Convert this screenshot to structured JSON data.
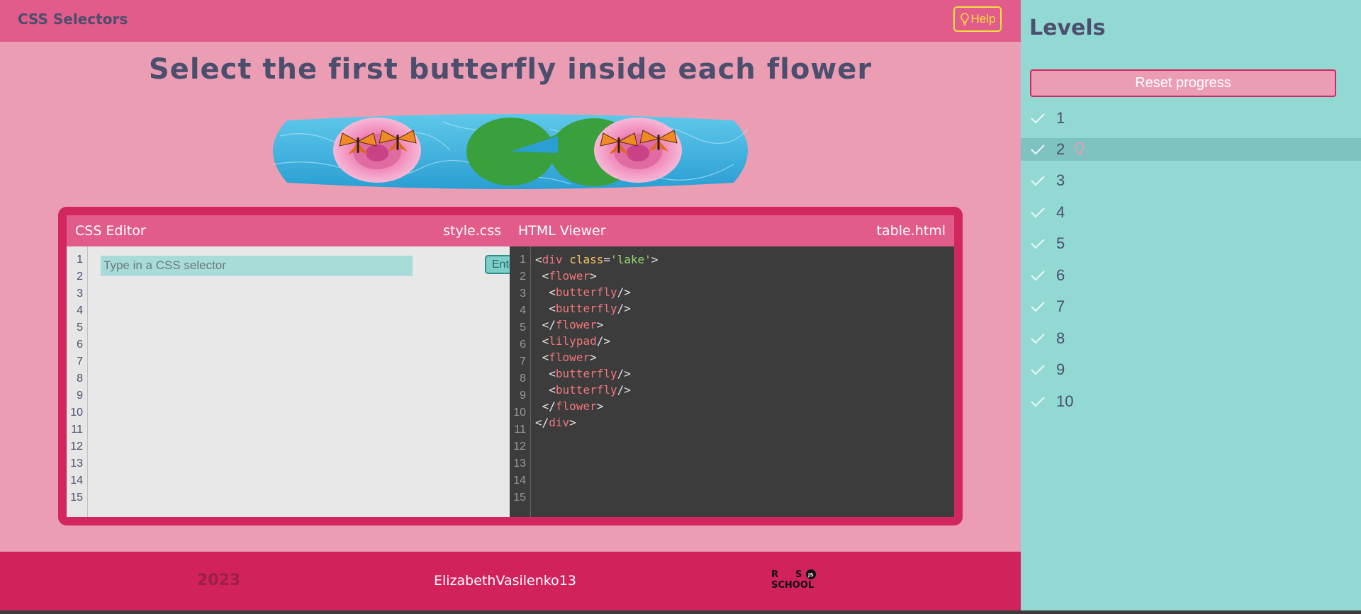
{
  "app": {
    "title": "CSS Selectors",
    "help_label": "Help"
  },
  "task": {
    "text": "Select the first butterfly inside each flower"
  },
  "editor": {
    "title": "CSS Editor",
    "filename": "style.css",
    "placeholder": "Type in a CSS selector",
    "enter_label": "Enter",
    "line_numbers": [
      "1",
      "2",
      "3",
      "4",
      "5",
      "6",
      "7",
      "8",
      "9",
      "10",
      "11",
      "12",
      "13",
      "14",
      "15"
    ]
  },
  "viewer": {
    "title": "HTML Viewer",
    "filename": "table.html",
    "line_numbers": [
      "1",
      "2",
      "3",
      "4",
      "5",
      "6",
      "7",
      "8",
      "9",
      "10",
      "11",
      "12",
      "13",
      "14",
      "15"
    ]
  },
  "footer": {
    "year": "2023",
    "author": "ElizabethVasilenko13",
    "logo_text": "RS SCHOOL"
  },
  "sidebar": {
    "title": "Levels",
    "reset_label": "Reset progress",
    "levels": [
      {
        "label": "1",
        "completed": true
      },
      {
        "label": "2",
        "completed": true,
        "hint_used": true,
        "active": true
      },
      {
        "label": "3",
        "completed": true
      },
      {
        "label": "4",
        "completed": true
      },
      {
        "label": "5",
        "completed": true
      },
      {
        "label": "6",
        "completed": true
      },
      {
        "label": "7",
        "completed": true
      },
      {
        "label": "8",
        "completed": true
      },
      {
        "label": "9",
        "completed": true
      },
      {
        "label": "10",
        "completed": true
      }
    ]
  },
  "icons": {
    "help": "lightbulb-icon",
    "check": "check-icon",
    "hint": "lightbulb-icon"
  },
  "colors": {
    "main_bg": "#eb9db3",
    "header": "#e15c8a",
    "accent": "#d1265e",
    "sidebar_bg": "#92d9d4",
    "text": "#4b4e6d",
    "help": "#f7e23b"
  }
}
